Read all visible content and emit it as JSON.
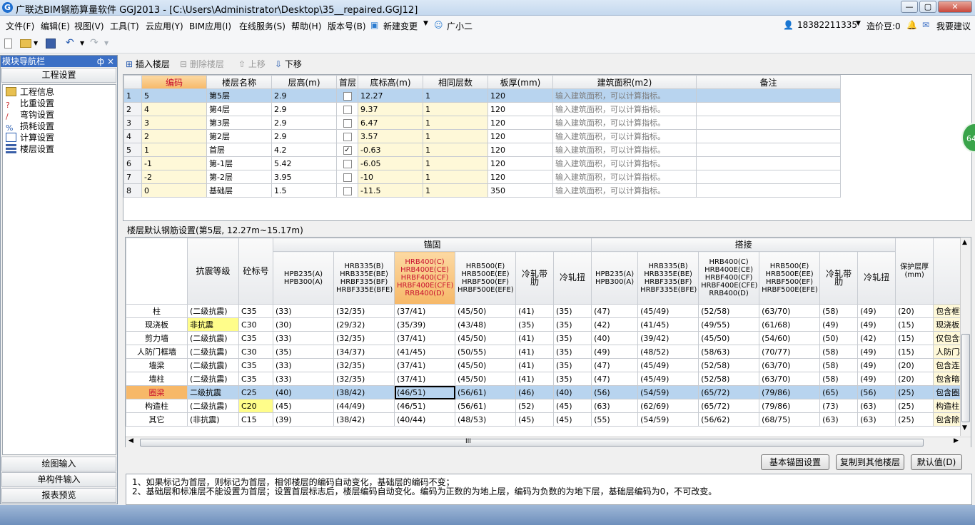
{
  "window": {
    "title": "广联达BIM钢筋算量软件 GGJ2013 - [C:\\Users\\Administrator\\Desktop\\35__repaired.GGJ12]",
    "icon": "app-logo-icon",
    "controls": [
      "minimize-icon",
      "maximize-icon",
      "close-icon"
    ]
  },
  "menubar": {
    "items": [
      "文件(F)",
      "编辑(E)",
      "视图(V)",
      "工具(T)",
      "云应用(Y)",
      "BIM应用(I)",
      "在线服务(S)",
      "帮助(H)",
      "版本号(B)",
      "新建变更",
      "广小二"
    ],
    "account": "18382211335",
    "bean": "造价豆:0",
    "suggest": "我要建议"
  },
  "toolbar": {
    "icons": [
      "new-file-icon",
      "open-folder-icon",
      "save-icon",
      "undo-icon",
      "redo-icon"
    ]
  },
  "nav": {
    "title": "模块导航栏",
    "pin": "ф",
    "close": "×",
    "section_top": "工程设置",
    "items": [
      "工程信息",
      "比重设置",
      "弯钩设置",
      "损耗设置",
      "计算设置",
      "楼层设置"
    ],
    "sections_bottom": [
      "绘图输入",
      "单构件输入",
      "报表预览"
    ]
  },
  "floorbar": {
    "insert": "插入楼层",
    "delete": "删除楼层",
    "up": "上移",
    "down": "下移"
  },
  "floortable": {
    "headers": [
      "编码",
      "楼层名称",
      "层高(m)",
      "首层",
      "底标高(m)",
      "相同层数",
      "板厚(mm)",
      "建筑面积(m2)",
      "备注"
    ],
    "placeholder": "输入建筑面积，可以计算指标。",
    "rows": [
      {
        "n": "1",
        "code": "5",
        "name": "第5层",
        "h": "2.9",
        "first": false,
        "base": "12.27",
        "same": "1",
        "thk": "120"
      },
      {
        "n": "2",
        "code": "4",
        "name": "第4层",
        "h": "2.9",
        "first": false,
        "base": "9.37",
        "same": "1",
        "thk": "120"
      },
      {
        "n": "3",
        "code": "3",
        "name": "第3层",
        "h": "2.9",
        "first": false,
        "base": "6.47",
        "same": "1",
        "thk": "120"
      },
      {
        "n": "4",
        "code": "2",
        "name": "第2层",
        "h": "2.9",
        "first": false,
        "base": "3.57",
        "same": "1",
        "thk": "120"
      },
      {
        "n": "5",
        "code": "1",
        "name": "首层",
        "h": "4.2",
        "first": true,
        "base": "-0.63",
        "same": "1",
        "thk": "120"
      },
      {
        "n": "6",
        "code": "-1",
        "name": "第-1层",
        "h": "5.42",
        "first": false,
        "base": "-6.05",
        "same": "1",
        "thk": "120"
      },
      {
        "n": "7",
        "code": "-2",
        "name": "第-2层",
        "h": "3.95",
        "first": false,
        "base": "-10",
        "same": "1",
        "thk": "120"
      },
      {
        "n": "8",
        "code": "0",
        "name": "基础层",
        "h": "1.5",
        "first": false,
        "base": "-11.5",
        "same": "1",
        "thk": "350"
      }
    ]
  },
  "rebar": {
    "title": "楼层默认钢筋设置(第5层, 12.27m~15.17m)",
    "group_anchor": "锚固",
    "group_lap": "搭接",
    "col_grade": "抗震等级",
    "col_concrete": "砼标号",
    "col_types": [
      "HPB235(A) HPB300(A)",
      "HRB335(B) HRB335E(BE) HRBF335(BF) HRBF335E(BFE)",
      "HRB400(C) HRB400E(CE) HRBF400(CF) HRBF400E(CFE) RRB400(D)",
      "HRB500(E) HRB500E(EE) HRBF500(EF) HRBF500E(EFE)",
      "冷轧带肋",
      "冷轧扭"
    ],
    "col_cover": "保护层厚(mm)",
    "rows": [
      {
        "name": "柱",
        "grade": "(二级抗震)",
        "c": "C35",
        "a": [
          "(33)",
          "(32/35)",
          "(37/41)",
          "(45/50)",
          "(41)",
          "(35)"
        ],
        "l": [
          "(47)",
          "(45/49)",
          "(52/58)",
          "(63/70)",
          "(58)",
          "(49)"
        ],
        "cover": "(20)",
        "note": "包含框架柱"
      },
      {
        "name": "现浇板",
        "grade": "非抗震",
        "c": "C30",
        "a": [
          "(30)",
          "(29/32)",
          "(35/39)",
          "(43/48)",
          "(35)",
          "(35)"
        ],
        "l": [
          "(42)",
          "(41/45)",
          "(49/55)",
          "(61/68)",
          "(49)",
          "(49)"
        ],
        "cover": "(15)",
        "note": "现浇板、螺"
      },
      {
        "name": "剪力墙",
        "grade": "(二级抗震)",
        "c": "C35",
        "a": [
          "(33)",
          "(32/35)",
          "(37/41)",
          "(45/50)",
          "(41)",
          "(35)"
        ],
        "l": [
          "(40)",
          "(39/42)",
          "(45/50)",
          "(54/60)",
          "(50)",
          "(42)"
        ],
        "cover": "(15)",
        "note": "仅包含墙身"
      },
      {
        "name": "人防门框墙",
        "grade": "(二级抗震)",
        "c": "C30",
        "a": [
          "(35)",
          "(34/37)",
          "(41/45)",
          "(50/55)",
          "(41)",
          "(35)"
        ],
        "l": [
          "(49)",
          "(48/52)",
          "(58/63)",
          "(70/77)",
          "(58)",
          "(49)"
        ],
        "cover": "(15)",
        "note": "人防门框墙"
      },
      {
        "name": "墙梁",
        "grade": "(二级抗震)",
        "c": "C35",
        "a": [
          "(33)",
          "(32/35)",
          "(37/41)",
          "(45/50)",
          "(41)",
          "(35)"
        ],
        "l": [
          "(47)",
          "(45/49)",
          "(52/58)",
          "(63/70)",
          "(58)",
          "(49)"
        ],
        "cover": "(20)",
        "note": "包含连梁、"
      },
      {
        "name": "墙柱",
        "grade": "(二级抗震)",
        "c": "C35",
        "a": [
          "(33)",
          "(32/35)",
          "(37/41)",
          "(45/50)",
          "(41)",
          "(35)"
        ],
        "l": [
          "(47)",
          "(45/49)",
          "(52/58)",
          "(63/70)",
          "(58)",
          "(49)"
        ],
        "cover": "(20)",
        "note": "包含暗柱、"
      },
      {
        "name": "圈梁",
        "grade": "二级抗震",
        "c": "C25",
        "a": [
          "(40)",
          "(38/42)",
          "(46/51)",
          "(56/61)",
          "(46)",
          "(40)"
        ],
        "l": [
          "(56)",
          "(54/59)",
          "(65/72)",
          "(79/86)",
          "(65)",
          "(56)"
        ],
        "cover": "(25)",
        "note": "包含圈梁、"
      },
      {
        "name": "构造柱",
        "grade": "(二级抗震)",
        "c": "C20",
        "a": [
          "(45)",
          "(44/49)",
          "(46/51)",
          "(56/61)",
          "(52)",
          "(45)"
        ],
        "l": [
          "(63)",
          "(62/69)",
          "(65/72)",
          "(79/86)",
          "(73)",
          "(63)"
        ],
        "cover": "(25)",
        "note": "构造柱"
      },
      {
        "name": "其它",
        "grade": "(非抗震)",
        "c": "C15",
        "a": [
          "(39)",
          "(38/42)",
          "(40/44)",
          "(48/53)",
          "(45)",
          "(45)"
        ],
        "l": [
          "(55)",
          "(54/59)",
          "(56/62)",
          "(68/75)",
          "(63)",
          "(63)"
        ],
        "cover": "(25)",
        "note": "包含除以上"
      }
    ]
  },
  "buttons": {
    "anchor": "基本锚固设置",
    "copy": "复制到其他楼层",
    "default": "默认值(D)"
  },
  "notes": [
    "1、如果标记为首层，则标记为首层，相邻楼层的编码自动变化，基础层的编码不变；",
    "2、基础层和标准层不能设置为首层；设置首层标志后，楼层编码自动变化。编码为正数的为地上层，编码为负数的为地下层，基础层编码为0，不可改变。"
  ],
  "float_badge": "64",
  "scroll_mark": "III",
  "colors": {
    "accent": "#3b6fc5",
    "selected_row": "#b8d4ef",
    "highlight": "#fef8d8"
  }
}
